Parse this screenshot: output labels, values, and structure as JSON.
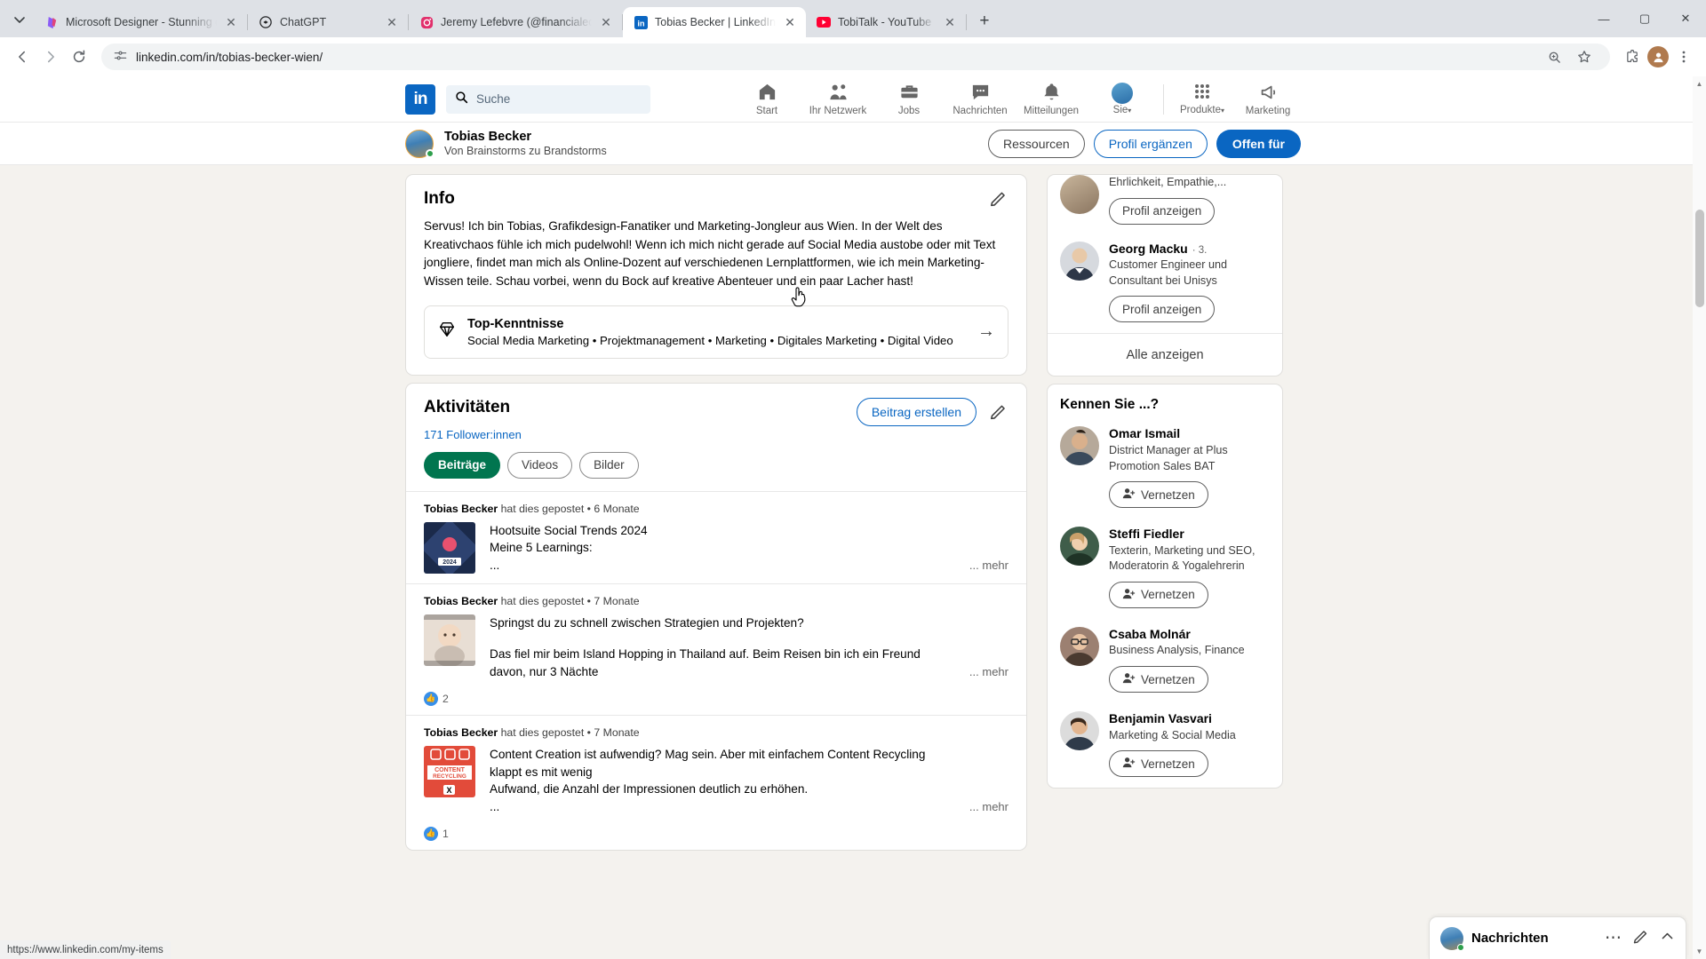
{
  "browser": {
    "tabs": [
      {
        "title": "Microsoft Designer - Stunning d",
        "favicon": "designer-icon",
        "active": false
      },
      {
        "title": "ChatGPT",
        "favicon": "chatgpt-icon",
        "active": false
      },
      {
        "title": "Jeremy Lefebvre (@financialeduc",
        "favicon": "instagram-icon",
        "active": false
      },
      {
        "title": "Tobias Becker | LinkedIn",
        "favicon": "linkedin-icon",
        "active": true
      },
      {
        "title": "TobiTalk - YouTube",
        "favicon": "youtube-icon",
        "active": false
      }
    ],
    "newtab_label": "+",
    "close_label": "✕",
    "url": "linkedin.com/in/tobias-becker-wien/",
    "window_controls": {
      "minimize": "—",
      "maximize": "▢",
      "close": "✕"
    },
    "status_url": "https://www.linkedin.com/my-items"
  },
  "linkedin": {
    "logo": "in",
    "search": {
      "placeholder": "Suche",
      "value": ""
    },
    "nav": [
      {
        "label": "Start",
        "icon": "home-icon"
      },
      {
        "label": "Ihr Netzwerk",
        "icon": "network-icon"
      },
      {
        "label": "Jobs",
        "icon": "briefcase-icon"
      },
      {
        "label": "Nachrichten",
        "icon": "message-icon"
      },
      {
        "label": "Mitteilungen",
        "icon": "bell-icon"
      },
      {
        "label": "Sie",
        "icon": "avatar-icon",
        "caret": "▾"
      },
      {
        "label": "Produkte",
        "icon": "grid-icon",
        "caret": "▾"
      },
      {
        "label": "Marketing",
        "icon": "marketing-icon"
      }
    ],
    "sticky": {
      "name": "Tobias Becker",
      "headline": "Von Brainstorms zu Brandstorms",
      "buttons": {
        "resources": "Ressourcen",
        "enhance": "Profil ergänzen",
        "open_to": "Offen für"
      }
    },
    "info": {
      "title": "Info",
      "text": "Servus! Ich bin Tobias, Grafikdesign-Fanatiker und Marketing-Jongleur aus Wien. In der Welt des Kreativchaos fühle ich mich pudelwohl! Wenn ich mich nicht gerade auf Social Media austobe oder mit Text jongliere, findet man mich als Online-Dozent auf verschiedenen Lernplattformen, wie ich mein Marketing-Wissen teile. Schau vorbei, wenn du Bock auf kreative Abenteuer und ein paar Lacher hast!",
      "skills_title": "Top-Kenntnisse",
      "skills_list": "Social Media Marketing • Projektmanagement • Marketing • Digitales Marketing • Digital Video",
      "arrow": "→"
    },
    "activity": {
      "title": "Aktivitäten",
      "followers": "171 Follower:innen",
      "create_post": "Beitrag erstellen",
      "filters": [
        {
          "label": "Beiträge",
          "selected": true
        },
        {
          "label": "Videos",
          "selected": false
        },
        {
          "label": "Bilder",
          "selected": false
        }
      ],
      "posts": [
        {
          "author": "Tobias Becker",
          "meta": " hat dies gepostet • 6 Monate",
          "line1": "Hootsuite Social Trends 2024",
          "line2": "Meine 5 Learnings:",
          "line3": "...",
          "more": "... mehr",
          "thumb": "hootsuite-2024-thumb",
          "reactions": ""
        },
        {
          "author": "Tobias Becker",
          "meta": " hat dies gepostet • 7 Monate",
          "line1": "Springst du zu schnell zwischen Strategien und Projekten?",
          "line2": "",
          "line3": "Das fiel mir beim Island Hopping in Thailand auf. Beim Reisen bin ich ein Freund davon, nur 3 Nächte",
          "more": "... mehr",
          "thumb": "baby-photo-thumb",
          "reactions": "2"
        },
        {
          "author": "Tobias Becker",
          "meta": " hat dies gepostet • 7 Monate",
          "line1": "Content Creation ist aufwendig? Mag sein. Aber mit einfachem Content Recycling klappt es mit wenig",
          "line2": "Aufwand, die Anzahl der Impressionen deutlich zu erhöhen.",
          "line3": "...",
          "more": "... mehr",
          "thumb": "content-recycling-thumb",
          "reactions": "1"
        }
      ]
    },
    "sidebar": {
      "partial_person": {
        "line1": "Ehrlichkeit, Empathie,...",
        "button": "Profil anzeigen"
      },
      "second_person": {
        "name": "Georg Macku",
        "degree": "· 3.",
        "title": "Customer Engineer und Consultant bei Unisys",
        "button": "Profil anzeigen"
      },
      "show_all": "Alle anzeigen",
      "people_title": "Kennen Sie ...?",
      "connect_label": "Vernetzen",
      "people": [
        {
          "name": "Omar Ismail",
          "title": "District Manager at Plus Promotion Sales BAT"
        },
        {
          "name": "Steffi Fiedler",
          "title": "Texterin, Marketing und SEO, Moderatorin & Yogalehrerin"
        },
        {
          "name": "Csaba Molnár",
          "title": "Business Analysis, Finance"
        },
        {
          "name": "Benjamin Vasvari",
          "title": "Marketing & Social Media"
        }
      ]
    },
    "messaging": {
      "title": "Nachrichten",
      "more": "⋯",
      "compose": "compose-icon",
      "chevron": "⌃"
    }
  },
  "colors": {
    "linkedin_blue": "#0a66c2",
    "green_pill": "#01754f",
    "chrome_tabstrip": "#dee1e6",
    "page_bg": "#f4f2ee"
  }
}
